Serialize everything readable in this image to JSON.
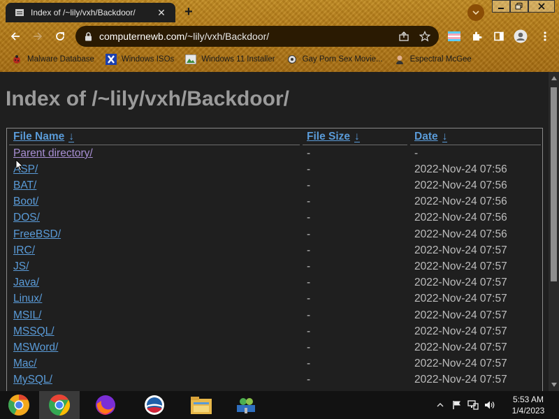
{
  "browser": {
    "tab_title": "Index of /~lily/vxh/Backdoor/",
    "url_host": "computernewb.com",
    "url_path": "/~lily/vxh/Backdoor/",
    "bookmarks": [
      {
        "label": "Malware Database",
        "icon": "ladybug-icon"
      },
      {
        "label": "Windows ISOs",
        "icon": "x-logo-icon"
      },
      {
        "label": "Windows 11 Installer",
        "icon": "image-thumb-icon"
      },
      {
        "label": "Gay Porn Sex Movie...",
        "icon": "gear-bookmark-icon"
      },
      {
        "label": "Espectral McGee",
        "icon": "avatar-icon"
      }
    ]
  },
  "page": {
    "heading": "Index of /~lily/vxh/Backdoor/",
    "columns": {
      "name": "File Name",
      "size": "File Size",
      "date": "Date",
      "sort_arrow": "↓"
    },
    "rows": [
      {
        "name": "Parent directory/",
        "size": "-",
        "date": "-",
        "visited": true
      },
      {
        "name": "ASP/",
        "size": "-",
        "date": "2022-Nov-24 07:56"
      },
      {
        "name": "BAT/",
        "size": "-",
        "date": "2022-Nov-24 07:56"
      },
      {
        "name": "Boot/",
        "size": "-",
        "date": "2022-Nov-24 07:56"
      },
      {
        "name": "DOS/",
        "size": "-",
        "date": "2022-Nov-24 07:56"
      },
      {
        "name": "FreeBSD/",
        "size": "-",
        "date": "2022-Nov-24 07:56"
      },
      {
        "name": "IRC/",
        "size": "-",
        "date": "2022-Nov-24 07:57"
      },
      {
        "name": "JS/",
        "size": "-",
        "date": "2022-Nov-24 07:57"
      },
      {
        "name": "Java/",
        "size": "-",
        "date": "2022-Nov-24 07:57"
      },
      {
        "name": "Linux/",
        "size": "-",
        "date": "2022-Nov-24 07:57"
      },
      {
        "name": "MSIL/",
        "size": "-",
        "date": "2022-Nov-24 07:57"
      },
      {
        "name": "MSSQL/",
        "size": "-",
        "date": "2022-Nov-24 07:57"
      },
      {
        "name": "MSWord/",
        "size": "-",
        "date": "2022-Nov-24 07:57"
      },
      {
        "name": "Mac/",
        "size": "-",
        "date": "2022-Nov-24 07:57"
      },
      {
        "name": "MySQL/",
        "size": "-",
        "date": "2022-Nov-24 07:57"
      }
    ]
  },
  "taskbar": {
    "time": "5:53 AM",
    "date": "1/4/2023",
    "apps": [
      "chrome-canary-icon",
      "chrome-icon",
      "firefox-icon",
      "obama-logo-icon",
      "file-explorer-icon",
      "network-people-icon"
    ]
  },
  "colors": {
    "link": "#5a9bd8",
    "visited_link": "#a88fd4",
    "page_bg": "#1f1f1f",
    "heading": "#9b9b9b",
    "frame_gold": "#b37a18"
  }
}
